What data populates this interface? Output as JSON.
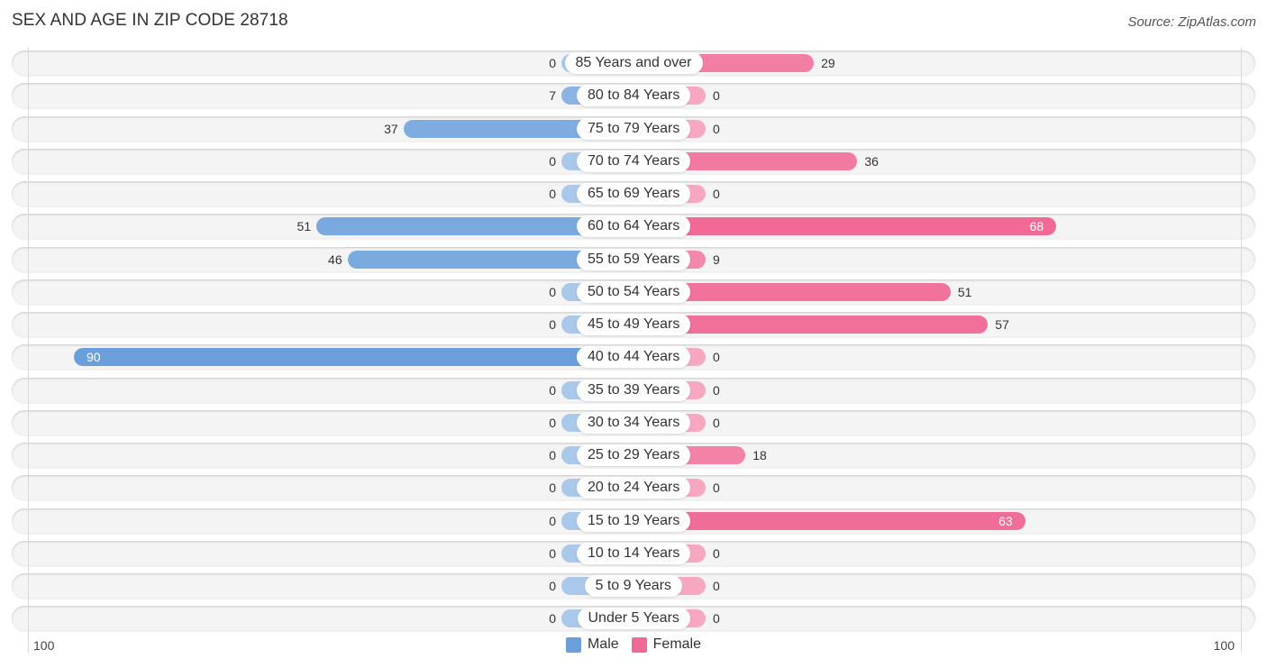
{
  "header": {
    "title": "SEX AND AGE IN ZIP CODE 28718",
    "source": "Source: ZipAtlas.com"
  },
  "colors": {
    "male_strong": "#6a9fdb",
    "male_light": "#a9c8ea",
    "female_strong": "#f06a95",
    "female_light": "#f7a8c0",
    "track": "#f4f4f4"
  },
  "chart_data": {
    "type": "bar",
    "orientation": "horizontal-diverging",
    "title": "SEX AND AGE IN ZIP CODE 28718",
    "xlabel": "",
    "ylabel": "",
    "xlim": [
      -100,
      100
    ],
    "tick_labels": {
      "left": "100",
      "right": "100"
    },
    "legend_position": "bottom-center",
    "grid": false,
    "categories": [
      "85 Years and over",
      "80 to 84 Years",
      "75 to 79 Years",
      "70 to 74 Years",
      "65 to 69 Years",
      "60 to 64 Years",
      "55 to 59 Years",
      "50 to 54 Years",
      "45 to 49 Years",
      "40 to 44 Years",
      "35 to 39 Years",
      "30 to 34 Years",
      "25 to 29 Years",
      "20 to 24 Years",
      "15 to 19 Years",
      "10 to 14 Years",
      "5 to 9 Years",
      "Under 5 Years"
    ],
    "series": [
      {
        "name": "Male",
        "side": "left",
        "values": [
          0,
          7,
          37,
          0,
          0,
          51,
          46,
          0,
          0,
          90,
          0,
          0,
          0,
          0,
          0,
          0,
          0,
          0
        ]
      },
      {
        "name": "Female",
        "side": "right",
        "values": [
          29,
          0,
          0,
          36,
          0,
          68,
          9,
          51,
          57,
          0,
          0,
          0,
          18,
          0,
          63,
          0,
          0,
          0
        ]
      }
    ]
  },
  "legend": {
    "male_label": "Male",
    "female_label": "Female"
  }
}
